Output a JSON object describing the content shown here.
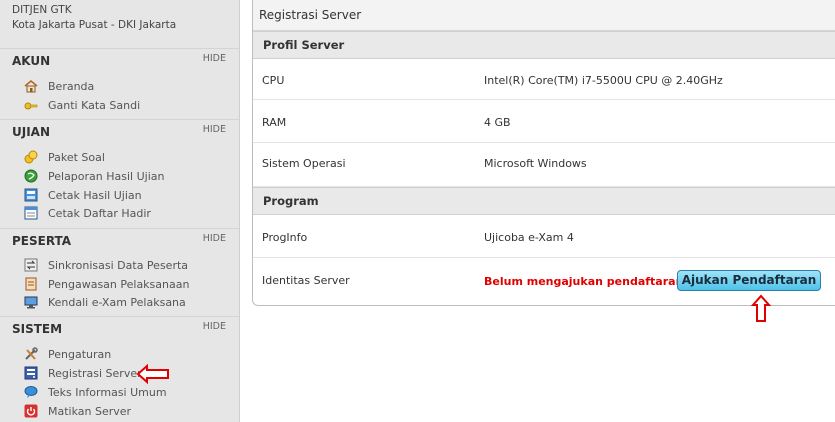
{
  "org": {
    "name": "DITJEN GTK",
    "location": "Kota Jakarta Pusat - DKI Jakarta"
  },
  "sidebar": {
    "hide_label": "HIDE",
    "sections": [
      {
        "title": "AKUN",
        "items": [
          {
            "label": "Beranda",
            "icon": "home-icon"
          },
          {
            "label": "Ganti Kata Sandi",
            "icon": "key-icon"
          }
        ]
      },
      {
        "title": "UJIAN",
        "items": [
          {
            "label": "Paket Soal",
            "icon": "coins-icon"
          },
          {
            "label": "Pelaporan Hasil Ujian",
            "icon": "globe-icon"
          },
          {
            "label": "Cetak Hasil Ujian",
            "icon": "print-icon"
          },
          {
            "label": "Cetak Daftar Hadir",
            "icon": "document-icon"
          }
        ]
      },
      {
        "title": "PESERTA",
        "items": [
          {
            "label": "Sinkronisasi Data Peserta",
            "icon": "sync-icon"
          },
          {
            "label": "Pengawasan Pelaksanaan",
            "icon": "clipboard-icon"
          },
          {
            "label": "Kendali e-Xam Pelaksana",
            "icon": "monitor-icon"
          }
        ]
      },
      {
        "title": "SISTEM",
        "items": [
          {
            "label": "Pengaturan",
            "icon": "tools-icon"
          },
          {
            "label": "Registrasi Server",
            "icon": "server-icon"
          },
          {
            "label": "Teks Informasi Umum",
            "icon": "chat-icon"
          },
          {
            "label": "Matikan Server",
            "icon": "power-icon"
          }
        ]
      }
    ]
  },
  "panel": {
    "title": "Registrasi Server",
    "profil_head": "Profil Server",
    "rows_profil": [
      {
        "label": "CPU",
        "value": "Intel(R) Core(TM) i7-5500U CPU @ 2.40GHz"
      },
      {
        "label": "RAM",
        "value": "4 GB"
      },
      {
        "label": "Sistem Operasi",
        "value": "Microsoft Windows"
      }
    ],
    "program_head": "Program",
    "rows_program": [
      {
        "label": "ProgInfo",
        "value": "Ujicoba e-Xam 4"
      },
      {
        "label": "Identitas Server",
        "value": "Belum mengajukan pendaftaran"
      }
    ],
    "register_button": "Ajukan Pendaftaran"
  },
  "colors": {
    "warning": "#e00000",
    "arrow": "#e00000",
    "button": "#4fc2ea"
  }
}
